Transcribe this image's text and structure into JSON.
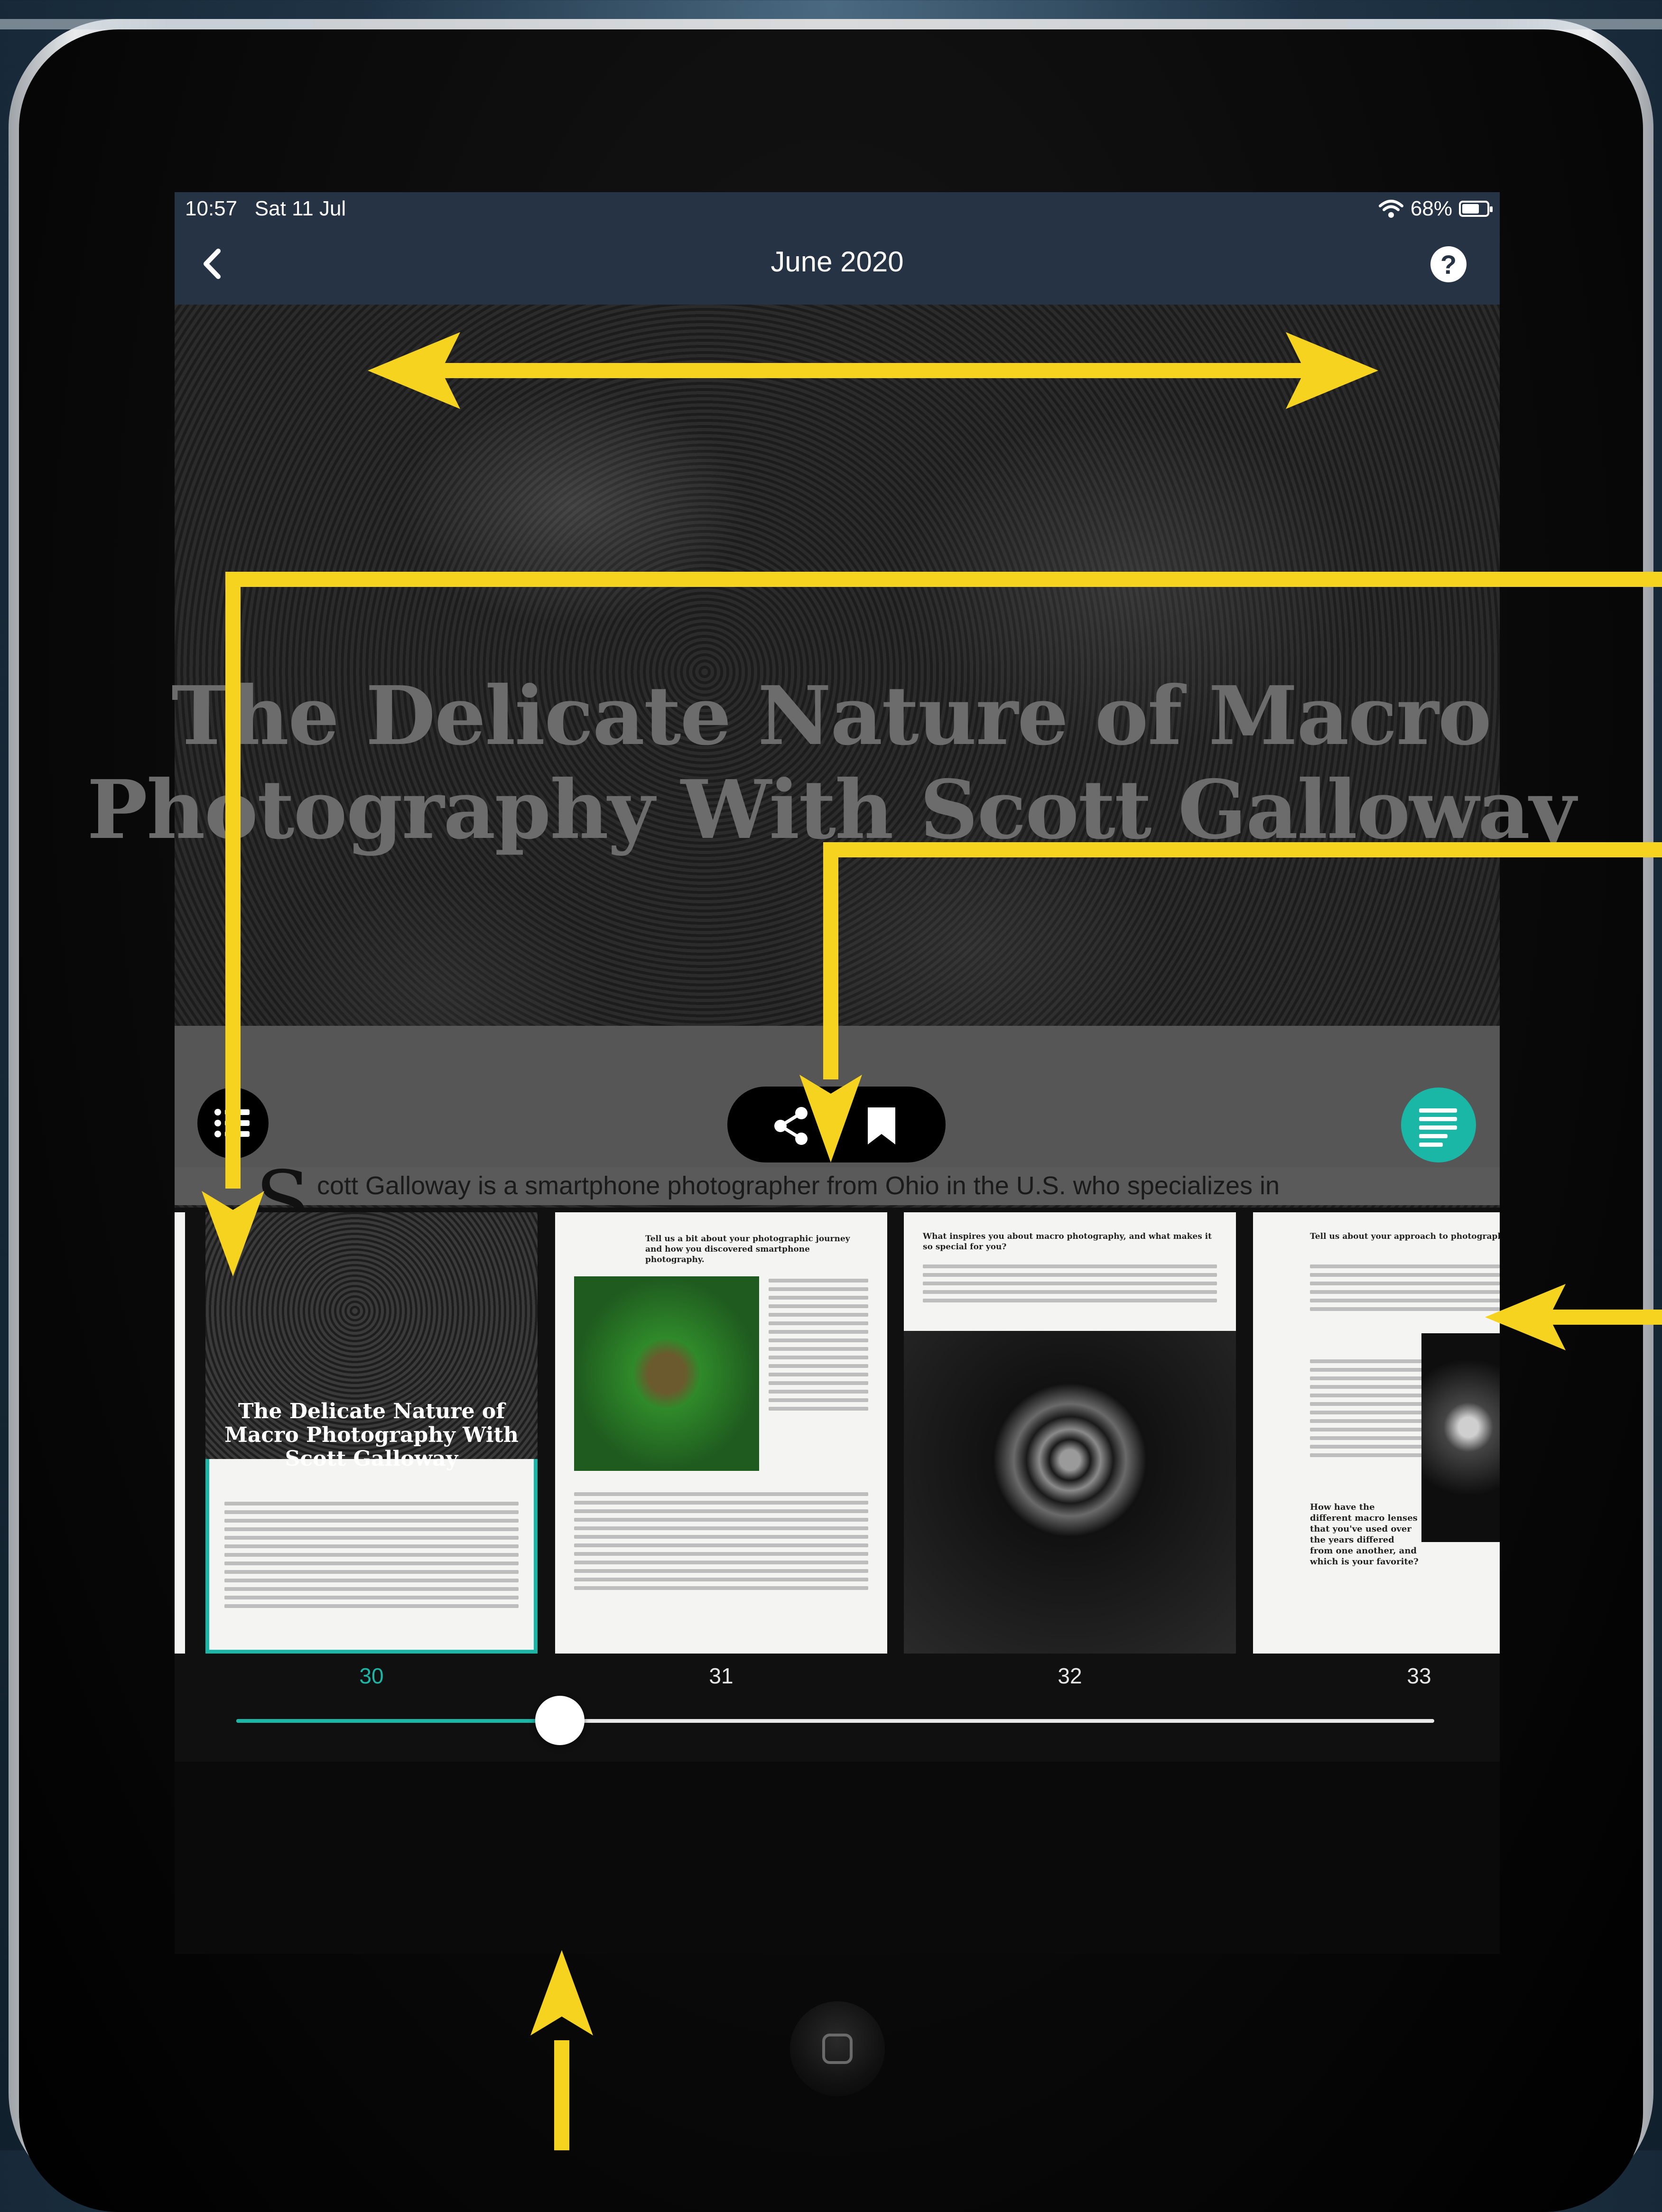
{
  "status_bar": {
    "time": "10:57",
    "date": "Sat 11 Jul",
    "battery": "68%"
  },
  "nav": {
    "title": "June 2020",
    "help_label": "?"
  },
  "article": {
    "title": "The Delicate Nature of Macro Photography With Scott Galloway",
    "drop_cap": "S",
    "first_line": "cott Galloway is a smartphone photographer from Ohio in the U.S. who specializes in"
  },
  "thumbnails": [
    {
      "page": "30",
      "title": "The Delicate Nature of Macro Photography With Scott Galloway",
      "selected": true
    },
    {
      "page": "31",
      "heading": "Tell us a bit about your photographic journey and how you discovered smartphone photography."
    },
    {
      "page": "32",
      "heading": "What inspires you about macro photography, and what makes it so special for you?"
    },
    {
      "page": "33",
      "heading": "Tell us about your approach to photograph... things compel you to take a photograph?",
      "subheading": "How have the different macro lenses that you've used over the years differed from one another, and which is your favorite?"
    }
  ],
  "slider": {
    "current_page": 30,
    "position_fraction": 0.27
  },
  "colors": {
    "accent": "#1ab6a6",
    "nav_bg": "#253345",
    "annotation": "#f5d31f"
  },
  "icons": [
    "back-chevron-icon",
    "help-icon",
    "wifi-icon",
    "battery-icon",
    "list-icon",
    "share-icon",
    "bookmark-icon",
    "text-view-icon",
    "home-button-icon"
  ]
}
